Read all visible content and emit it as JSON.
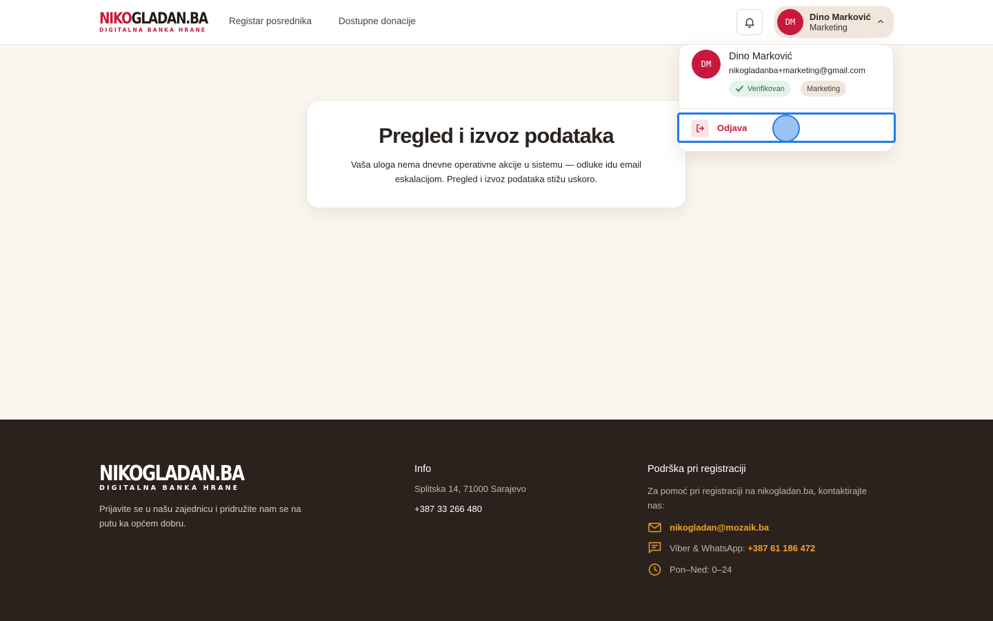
{
  "brand": {
    "logo_part1": "NIKO",
    "logo_part2": "GLADAN.BA",
    "logo_sub": "DIGITALNA BANKA HRANE",
    "footer_logo": "NIKOGLADAN.BA",
    "footer_logo_sub": "DIGITALNA BANKA HRANE"
  },
  "nav": {
    "items": [
      {
        "label": "Registar posrednika"
      },
      {
        "label": "Dostupne donacije"
      }
    ]
  },
  "user": {
    "initials": "DM",
    "name": "Dino Marković",
    "role": "Marketing",
    "email": "nikogladanba+marketing@gmail.com",
    "verified_label": "Verifikovan"
  },
  "dropdown": {
    "logout_label": "Odjava"
  },
  "main": {
    "title": "Pregled i izvoz podataka",
    "description": "Vaša uloga nema dnevne operativne akcije u sistemu — odluke idu email eskalacijom. Pregled i izvoz podataka stižu uskoro."
  },
  "footer": {
    "tagline": "Prijavite se u našu zajednicu i pridružite nam se na putu ka općem dobru.",
    "info_heading": "Info",
    "address": "Splitska 14, 71000 Sarajevo",
    "phone": "+387 33 266 480",
    "support_heading": "Podrška pri registraciji",
    "support_text": "Za pomoć pri registraciji na nikogladan.ba, kontaktirajte nas:",
    "email": "nikogladan@mozaik.ba",
    "messaging_prefix": "Viber & WhatsApp:",
    "messaging_number": "+387 61 186 472",
    "hours": "Pon–Ned: 0–24"
  },
  "colors": {
    "brand_red": "#c8193c",
    "accent_orange": "#f0a12a",
    "footer_bg": "#2b221d",
    "page_bg": "#faf5ef",
    "focus_blue": "#1e7be8"
  },
  "icons": [
    "bell-icon",
    "chevron-up-icon",
    "check-icon",
    "logout-icon",
    "mail-icon",
    "chat-icon",
    "clock-icon"
  ]
}
